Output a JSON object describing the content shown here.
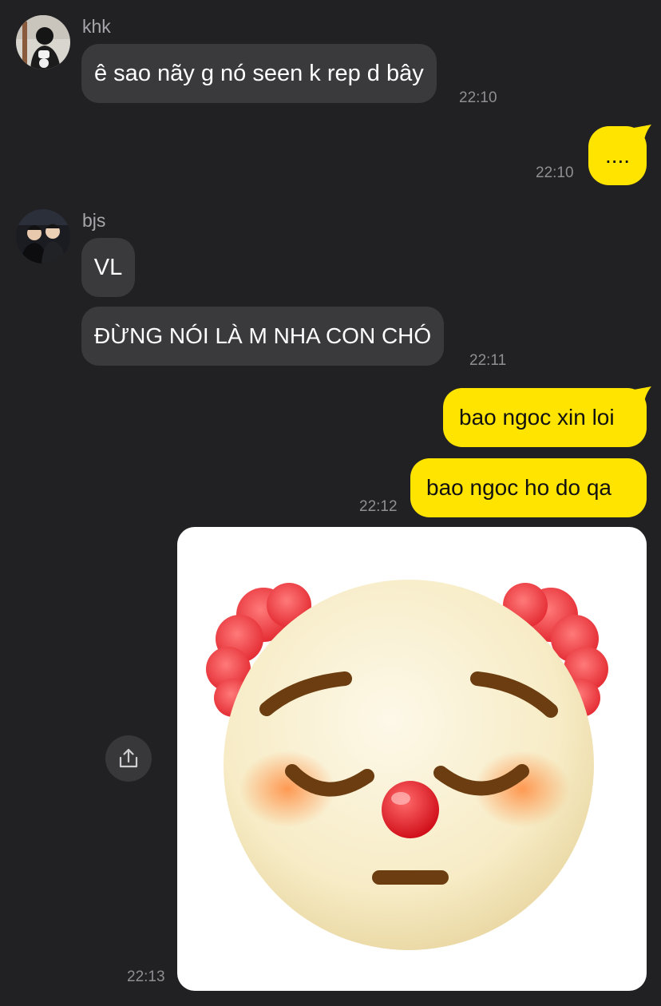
{
  "messages": {
    "m1": {
      "sender": "khk",
      "text": "ê sao nãy g nó seen k rep d bây",
      "time": "22:10"
    },
    "m2": {
      "text": "....",
      "time": "22:10"
    },
    "m3": {
      "sender": "bjs",
      "text": "VL"
    },
    "m4": {
      "text": "ĐỪNG NÓI LÀ M NHA CON CHÓ",
      "time": "22:11"
    },
    "m5": {
      "text": "bao ngoc xin loi"
    },
    "m6": {
      "text": "bao ngoc ho do qa",
      "time": "22:12"
    },
    "m7": {
      "image": "clown-face-emoji",
      "time": "22:13"
    }
  },
  "colors": {
    "background": "#212124",
    "incoming_bubble": "#3a3a3d",
    "outgoing_bubble": "#ffe400",
    "timestamp": "#8e8e93"
  },
  "icons": {
    "share": "share-icon"
  }
}
